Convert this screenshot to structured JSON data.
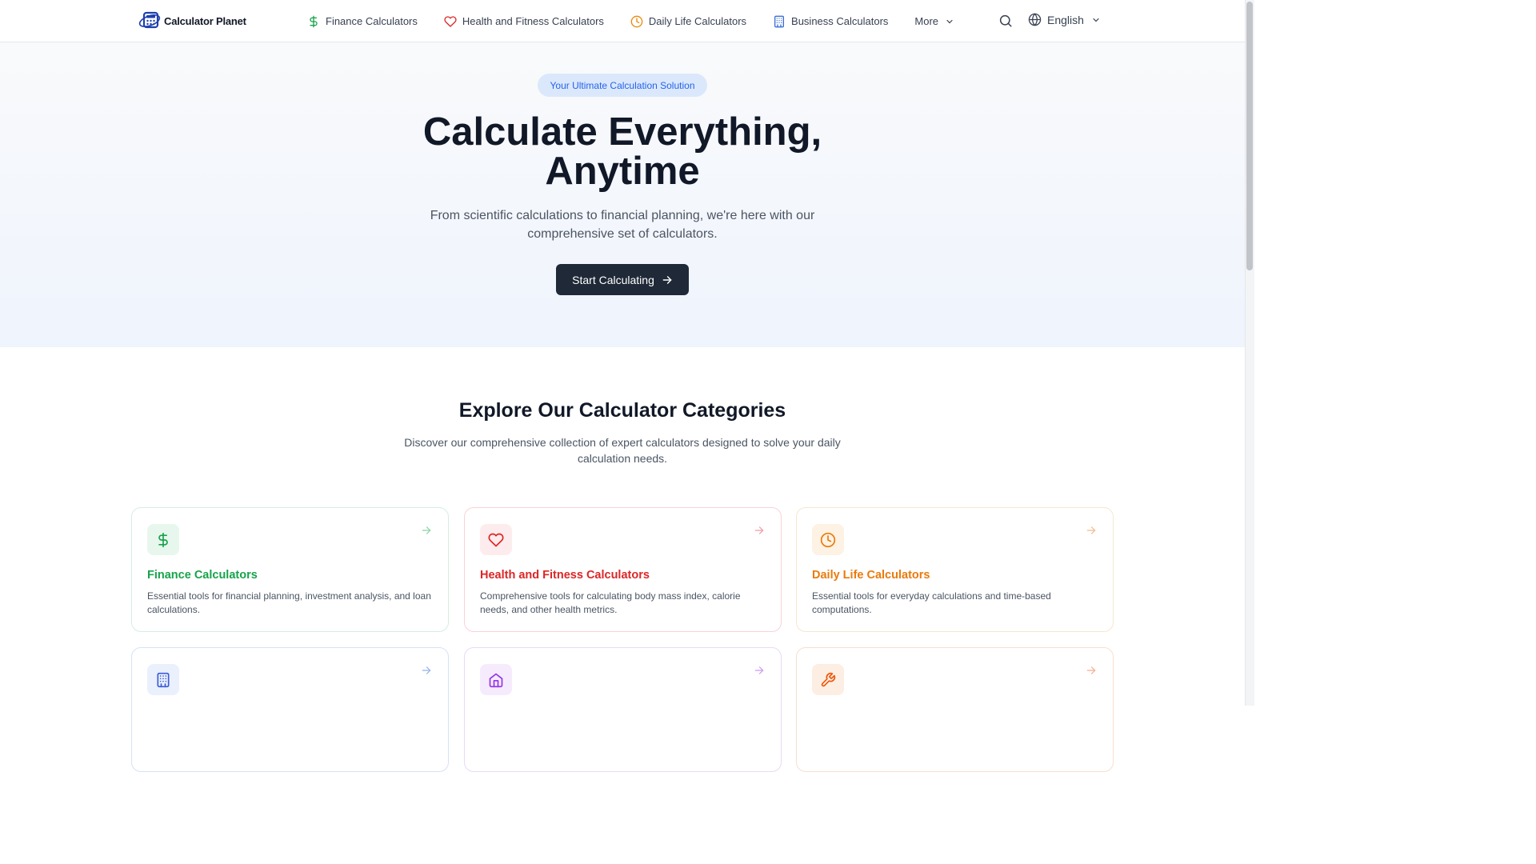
{
  "header": {
    "logo_text": "Calculator Planet",
    "nav": [
      {
        "label": "Finance Calculators",
        "icon": "dollar-icon",
        "color": "#16a34a"
      },
      {
        "label": "Health and Fitness Calculators",
        "icon": "heart-icon",
        "color": "#dc2626"
      },
      {
        "label": "Daily Life Calculators",
        "icon": "clock-icon",
        "color": "#ea8a0c"
      },
      {
        "label": "Business Calculators",
        "icon": "building-icon",
        "color": "#3b6fd6"
      }
    ],
    "more_label": "More",
    "language": "English"
  },
  "hero": {
    "badge": "Your Ultimate Calculation Solution",
    "title_line1": "Calculate Everything,",
    "title_line2": "Anytime",
    "subtitle": "From scientific calculations to financial planning, we're here with our comprehensive set of calculators.",
    "cta_label": "Start Calculating"
  },
  "categories": {
    "title": "Explore Our Calculator Categories",
    "subtitle": "Discover our comprehensive collection of expert calculators designed to solve your daily calculation needs.",
    "cards": [
      {
        "title": "Finance Calculators",
        "description": "Essential tools for financial planning, investment analysis, and loan calculations.",
        "icon": "dollar-icon",
        "color": "#16a34a",
        "bg": "#e8f7ee"
      },
      {
        "title": "Health and Fitness Calculators",
        "description": "Comprehensive tools for calculating body mass index, calorie needs, and other health metrics.",
        "icon": "heart-icon",
        "color": "#dc2626",
        "bg": "#fdecee"
      },
      {
        "title": "Daily Life Calculators",
        "description": "Essential tools for everyday calculations and time-based computations.",
        "icon": "clock-icon",
        "color": "#ea7a0c",
        "bg": "#fdf2e3"
      },
      {
        "title": "",
        "description": "",
        "icon": "building-icon",
        "color": "#3b5bd6",
        "bg": "#eaf0fc"
      },
      {
        "title": "",
        "description": "",
        "icon": "home-icon",
        "color": "#9333ea",
        "bg": "#f5ebfd"
      },
      {
        "title": "",
        "description": "",
        "icon": "wrench-icon",
        "color": "#ea580c",
        "bg": "#fdeee3"
      }
    ]
  }
}
